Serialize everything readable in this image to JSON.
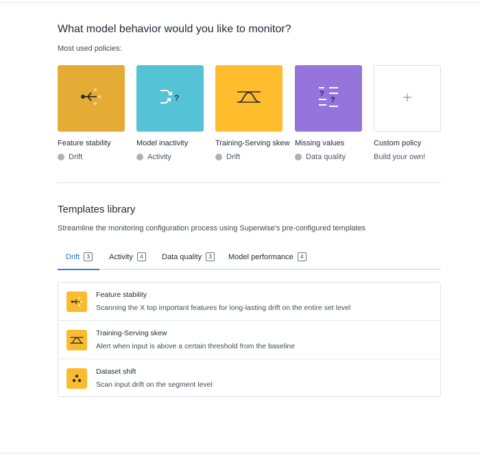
{
  "header": {
    "title": "What model behavior would you like to monitor?",
    "subtitle": "Most used policies:"
  },
  "policies": [
    {
      "name": "Feature stability",
      "category": "Drift",
      "icon": "feature-stability-icon",
      "color": "#E5AC35"
    },
    {
      "name": "Model inactivity",
      "category": "Activity",
      "icon": "model-inactivity-icon",
      "color": "#56C2D6"
    },
    {
      "name": "Training-Serving skew",
      "category": "Drift",
      "icon": "training-serving-skew-icon",
      "color": "#FFBD2E"
    },
    {
      "name": "Missing values",
      "category": "Data quality",
      "icon": "missing-values-icon",
      "color": "#9575DB"
    },
    {
      "name": "Custom policy",
      "category": "Build your own!",
      "icon": "plus-icon",
      "color": "#FFFFFF"
    }
  ],
  "library": {
    "title": "Templates library",
    "description": "Streamline the monitoring configuration process using Superwise's pre-configured templates",
    "tabs": [
      {
        "label": "Drift",
        "count": "3",
        "active": true
      },
      {
        "label": "Activity",
        "count": "4",
        "active": false
      },
      {
        "label": "Data quality",
        "count": "3",
        "active": false
      },
      {
        "label": "Model performance",
        "count": "4",
        "active": false
      }
    ],
    "templates": [
      {
        "name": "Feature stability",
        "description": "Scanning the X top important features for long-lasting drift on the entire set level",
        "icon": "feature-stability-icon"
      },
      {
        "name": "Training-Serving skew",
        "description": "Alert when input is above a certain threshold from the baseline",
        "icon": "training-serving-skew-icon"
      },
      {
        "name": "Dataset shift",
        "description": "Scan input drift on the segment level",
        "icon": "dataset-shift-icon"
      }
    ]
  },
  "colors": {
    "accent": "#2F7BD6",
    "template_icon_bg": "#FBBB2E",
    "category_dot": "#AAB3BD"
  }
}
